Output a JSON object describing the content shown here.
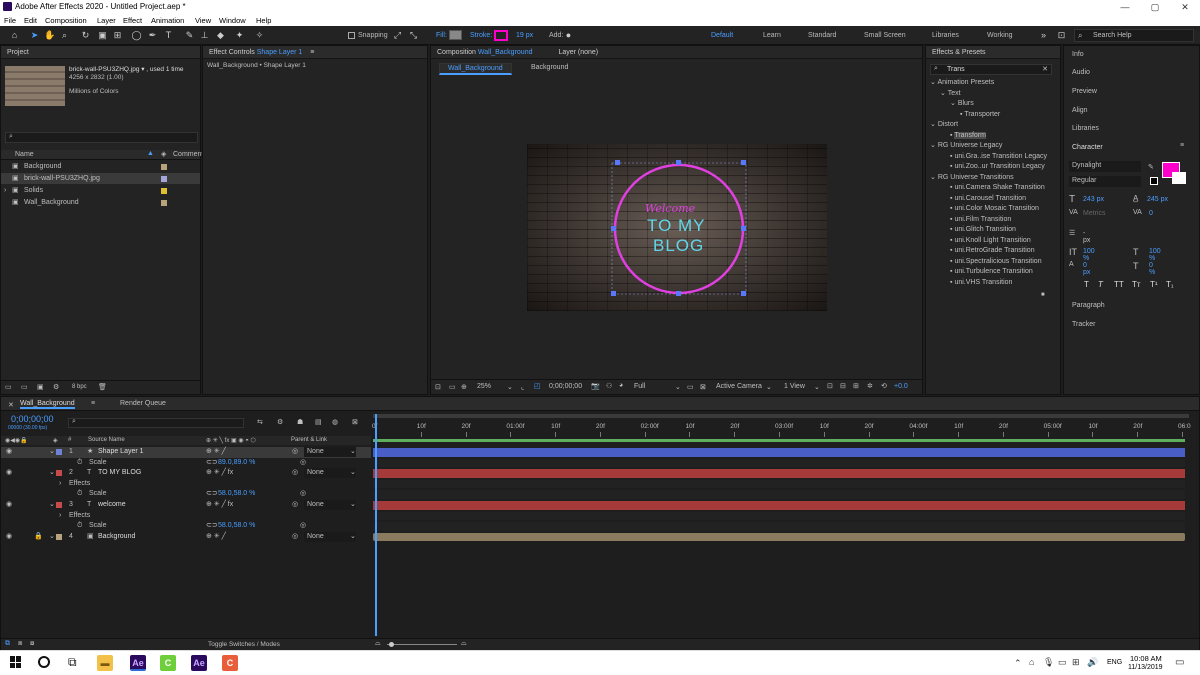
{
  "window": {
    "title": "Adobe After Effects 2020 - Untitled Project.aep *",
    "min": "—",
    "max": "▢",
    "close": "✕"
  },
  "menu": [
    "File",
    "Edit",
    "Composition",
    "Layer",
    "Effect",
    "Animation",
    "View",
    "Window",
    "Help"
  ],
  "toolbar": {
    "snapping": "Snapping",
    "fill": "Fill:",
    "stroke": "Stroke:",
    "stroke_px": "19 px",
    "add": "Add:",
    "workspaces": [
      "Default",
      "Learn",
      "Standard",
      "Small Screen",
      "Libraries",
      "Working"
    ],
    "search": "Search Help"
  },
  "project": {
    "title": "Project",
    "file": "brick-wall-PSU3ZHQ.jpg ▾ , used 1 time",
    "dims": "4256 x 2832 (1.00)",
    "colors": "Millions of Colors",
    "col_name": "Name",
    "col_comment": "Comment",
    "bpc": "8 bpc",
    "items": [
      {
        "name": "Background",
        "color": "#b8a37a"
      },
      {
        "name": "brick-wall-PSU3ZHQ.jpg",
        "color": "#a5a5d8"
      },
      {
        "name": "Solids",
        "color": "#e0c030"
      },
      {
        "name": "Wall_Background",
        "color": "#b8a37a"
      }
    ]
  },
  "effect_controls": {
    "label": "Effect Controls",
    "layer": "Shape Layer 1",
    "path": "Wall_Background • Shape Layer 1"
  },
  "composition": {
    "label": "Composition",
    "name": "Wall_Background",
    "layer_tab": "Layer (none)",
    "crumb1": "Wall_Background",
    "crumb2": "Background",
    "neon_script": "Welcome",
    "neon_l1": "TO MY",
    "neon_l2": "BLOG",
    "zoom": "25%",
    "time": "0;00;00;00",
    "res": "Full",
    "camera": "Active Camera",
    "view": "1 View",
    "offset": "+0.0"
  },
  "effects": {
    "title": "Effects & Presets",
    "search": "Trans",
    "tree": [
      "Animation Presets",
      "Text",
      "Blurs",
      "Transporter",
      "Distort",
      "Transform",
      "RG Universe Legacy",
      "uni.Gra..ise Transition Legacy",
      "uni.Zoo..ur Transition Legacy",
      "RG Universe Transitions",
      "uni.Camera Shake Transition",
      "uni.Carousel Transition",
      "uni.Color Mosaic Transition",
      "uni.Film Transition",
      "uni.Glitch Transition",
      "uni.Knoll Light Transition",
      "uni.RetroGrade Transition",
      "uni.Spectralicious Transition",
      "uni.Turbulence Transition",
      "uni.VHS Transition"
    ]
  },
  "right": {
    "info": "Info",
    "audio": "Audio",
    "preview": "Preview",
    "align": "Align",
    "libraries": "Libraries",
    "character": "Character",
    "font": "Dynalight",
    "style": "Regular",
    "size": "243 px",
    "leading": "245 px",
    "kern": "Metrics",
    "track": "0",
    "unit": "- px",
    "vscale": "100 %",
    "hscale": "100 %",
    "baseline": "0 px",
    "tsume": "0 %",
    "paragraph": "Paragraph",
    "tracker": "Tracker",
    "styles": [
      "T",
      "T",
      "TT",
      "Tт",
      "T¹",
      "T₁"
    ]
  },
  "timeline": {
    "comp": "Wall_Background",
    "render": "Render Queue",
    "time": "0;00;00;00",
    "fps": "00000 (30.00 fps)",
    "col_source": "Source Name",
    "col_parent": "Parent & Link",
    "toggle": "Toggle Switches / Modes",
    "ruler": [
      "0f",
      "10f",
      "20f",
      "01:00f",
      "10f",
      "20f",
      "02:00f",
      "10f",
      "20f",
      "03:00f",
      "10f",
      "20f",
      "04:00f",
      "10f",
      "20f",
      "05:00f",
      "10f",
      "20f",
      "06:0"
    ],
    "rows": [
      {
        "num": "1",
        "name": "Shape Layer 1",
        "color": "#6e82d6",
        "prop": "",
        "val": "",
        "parent": "None"
      },
      {
        "num": "",
        "name": "Scale",
        "color": "",
        "prop": "",
        "val": "89.0,89.0 %",
        "parent": ""
      },
      {
        "num": "2",
        "name": "TO MY  BLOG",
        "color": "#c84a4a",
        "prop": "",
        "val": "",
        "parent": "None"
      },
      {
        "num": "",
        "name": "Effects",
        "color": "",
        "prop": "",
        "val": "",
        "parent": ""
      },
      {
        "num": "",
        "name": "Scale",
        "color": "",
        "prop": "",
        "val": "58.0,58.0 %",
        "parent": ""
      },
      {
        "num": "3",
        "name": "welcome",
        "color": "#c84a4a",
        "prop": "",
        "val": "",
        "parent": "None"
      },
      {
        "num": "",
        "name": "Effects",
        "color": "",
        "prop": "",
        "val": "",
        "parent": ""
      },
      {
        "num": "",
        "name": "Scale",
        "color": "",
        "prop": "",
        "val": "58.0,58.0 %",
        "parent": ""
      },
      {
        "num": "4",
        "name": "Background",
        "color": "#b8a37a",
        "prop": "",
        "val": "",
        "parent": "None"
      }
    ]
  },
  "taskbar": {
    "time": "10:08 AM",
    "date": "11/13/2019",
    "lang": "ENG"
  },
  "colors": {
    "accent": "#4a9eff",
    "neon_pink": "#e040e0",
    "neon_cyan": "#5fd6e8",
    "fill": "#ff00cc"
  }
}
